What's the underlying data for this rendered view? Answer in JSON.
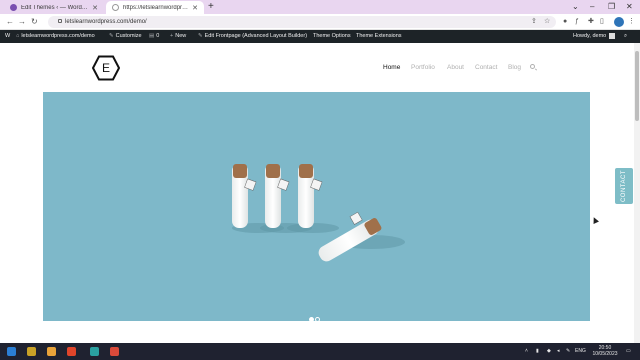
{
  "browser": {
    "tabs": [
      {
        "title": "Edit Themes ‹ — WordPress",
        "active": false
      },
      {
        "title": "https://letslearnwordpress.com/d",
        "active": true
      }
    ],
    "new_tab": "+",
    "address": "letslearnwordpress.com/demo/",
    "window_controls": {
      "minimize": "–",
      "restore": "❐",
      "close": "✕"
    },
    "dropdown": "⌄"
  },
  "admin_bar": {
    "wp_logo": "W",
    "site": "letslearnwordpress.com/demo",
    "customize": "Customize",
    "comments_count": "0",
    "new": "New",
    "edit_frontpage": "Edit Frontpage (Advanced Layout Builder)",
    "theme_options": "Theme Options",
    "theme_extensions": "Theme Extensions",
    "howdy": "Howdy, demo"
  },
  "site": {
    "logo_letter": "E",
    "nav": [
      "Home",
      "Portfolio",
      "About",
      "Contact",
      "Blog"
    ],
    "active_nav": "Home",
    "hero_bg": "#7eb8c9",
    "slides_total": 2,
    "slide_active": 1,
    "contact_tab": "CONTACT"
  },
  "taskbar": {
    "language": "ENG",
    "time": "20:50",
    "date": "10/05/2023"
  }
}
